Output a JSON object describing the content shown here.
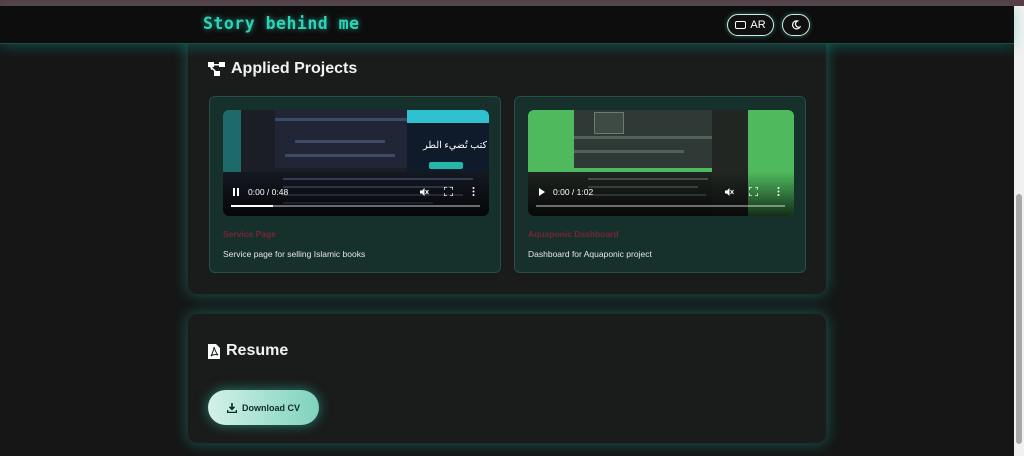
{
  "header": {
    "brand": "Story behind me",
    "lang_label": "AR",
    "icons": {
      "lang": "keyboard-icon",
      "theme": "moon-icon"
    }
  },
  "projects": {
    "title": "Applied Projects",
    "icon": "project-diagram-icon",
    "cards": [
      {
        "title": "Service Page",
        "description": "Service page for selling Islamic books",
        "video": {
          "time": "0:00 / 0:48",
          "state": "playing",
          "progress": 0.17,
          "overlay_text": "كتب تُضيء الطر"
        }
      },
      {
        "title": "Aquaponic Dashboard",
        "description": "Dashboard for Aquaponic project",
        "video": {
          "time": "0:00 / 1:02",
          "state": "paused",
          "progress": 0.0
        }
      }
    ]
  },
  "resume": {
    "title": "Resume",
    "icon": "file-pdf-icon",
    "download_label": "Download CV",
    "download_icon": "download-icon"
  },
  "colors": {
    "accent": "#2fd3b8",
    "card_bg": "#16302c",
    "card_title": "#7a2434"
  }
}
